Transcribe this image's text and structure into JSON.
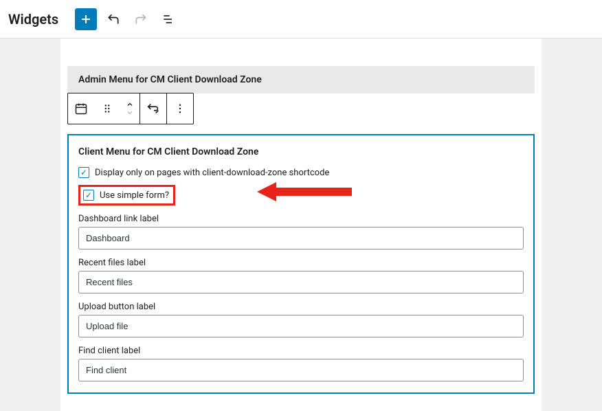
{
  "topbar": {
    "title": "Widgets"
  },
  "admin_widget": {
    "title": "Admin Menu for CM Client Download Zone"
  },
  "client_widget": {
    "title": "Client Menu for CM Client Download Zone",
    "check_shortcode": "Display only on pages with client-download-zone shortcode",
    "check_simple": "Use simple form?",
    "fields": {
      "dashboard": {
        "label": "Dashboard link label",
        "value": "Dashboard"
      },
      "recent": {
        "label": "Recent files label",
        "value": "Recent files"
      },
      "upload": {
        "label": "Upload button label",
        "value": "Upload file"
      },
      "find": {
        "label": "Find client label",
        "value": "Find client"
      }
    }
  }
}
